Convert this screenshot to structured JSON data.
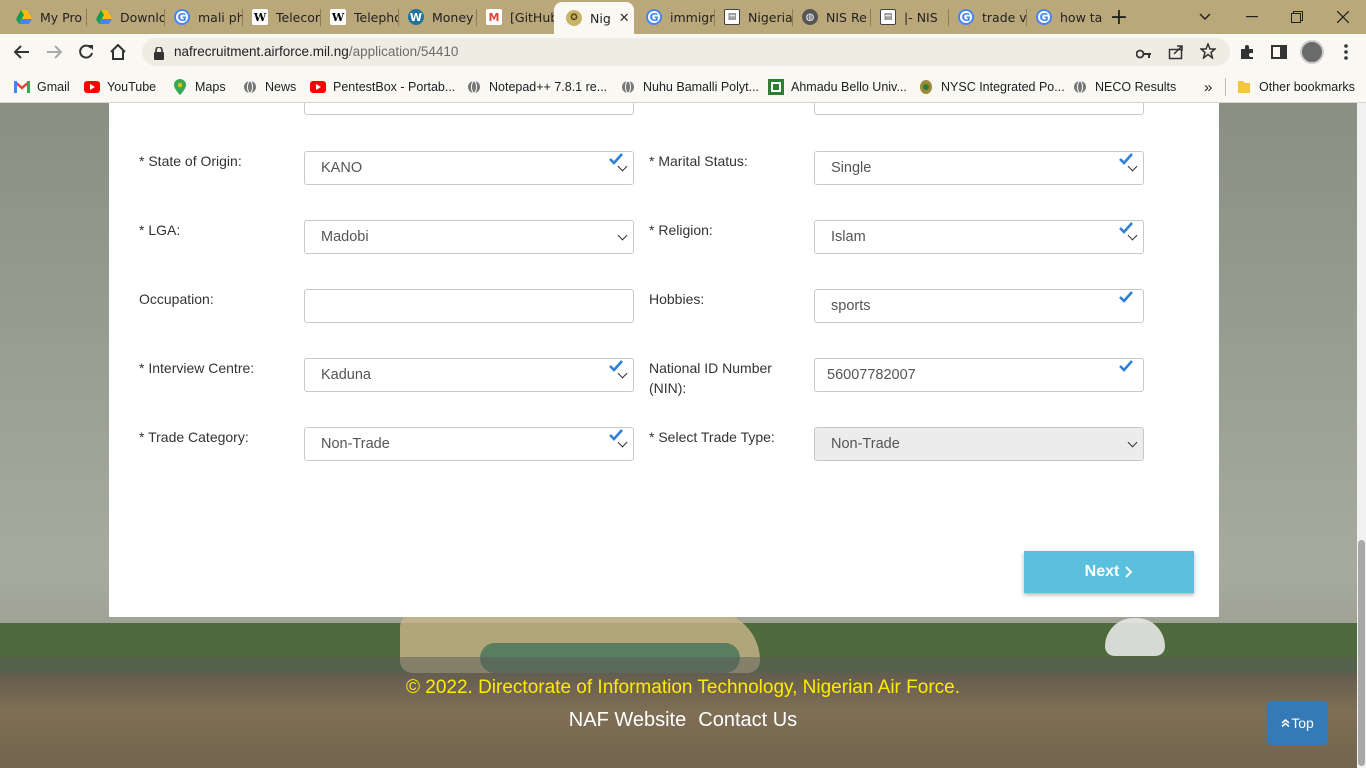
{
  "browser": {
    "tabs": [
      {
        "label": "My Pro",
        "icon": "google-drive-icon",
        "color": "#1a73e8"
      },
      {
        "label": "Downlo",
        "icon": "google-drive-icon",
        "color": "#1a73e8"
      },
      {
        "label": "mali ph",
        "icon": "google-icon",
        "color": "#4285f4"
      },
      {
        "label": "Telecor",
        "icon": "wikipedia-icon",
        "color": "#000000"
      },
      {
        "label": "Telepho",
        "icon": "wikipedia-icon",
        "color": "#000000"
      },
      {
        "label": "Money",
        "icon": "wordpress-icon",
        "color": "#21759b"
      },
      {
        "label": "[GitHub",
        "icon": "gmail-icon",
        "color": "#ea4335"
      },
      {
        "label": "Nig",
        "icon": "naf-crest-icon",
        "color": "#8a7a3a"
      },
      {
        "label": "immigr",
        "icon": "google-icon",
        "color": "#4285f4"
      },
      {
        "label": "Nigeria",
        "icon": "document-icon",
        "color": "#555555"
      },
      {
        "label": "NIS Re",
        "icon": "globe-icon",
        "color": "#555555"
      },
      {
        "label": "|- NIS",
        "icon": "document-icon",
        "color": "#555555"
      },
      {
        "label": "trade v",
        "icon": "google-icon",
        "color": "#4285f4"
      },
      {
        "label": "how ta",
        "icon": "google-icon",
        "color": "#4285f4"
      }
    ],
    "url_host": "nafrecruitment.airforce.mil.ng",
    "url_path": "/application/54410",
    "bookmarks": [
      {
        "label": "Gmail",
        "icon": "gmail-icon"
      },
      {
        "label": "YouTube",
        "icon": "youtube-icon"
      },
      {
        "label": "Maps",
        "icon": "maps-icon"
      },
      {
        "label": "News",
        "icon": "globe-icon"
      },
      {
        "label": "PentestBox - Portab...",
        "icon": "youtube-icon"
      },
      {
        "label": "Notepad++ 7.8.1 re...",
        "icon": "globe-icon"
      },
      {
        "label": "Nuhu Bamalli Polyt...",
        "icon": "globe-icon"
      },
      {
        "label": "Ahmadu Bello Univ...",
        "icon": "abu-crest-icon"
      },
      {
        "label": "NYSC Integrated Po...",
        "icon": "nysc-icon"
      },
      {
        "label": "NECO Results",
        "icon": "globe-icon"
      }
    ],
    "other_bookmarks": "Other bookmarks",
    "more": "»"
  },
  "form": {
    "state_label": "* State of Origin:",
    "state_value": "KANO",
    "marital_label": "* Marital Status:",
    "marital_value": "Single",
    "lga_label": "* LGA:",
    "lga_value": "Madobi",
    "religion_label": "* Religion:",
    "religion_value": "Islam",
    "occupation_label": "Occupation:",
    "occupation_value": "",
    "hobbies_label": "Hobbies:",
    "hobbies_value": "sports",
    "centre_label": "* Interview Centre:",
    "centre_value": "Kaduna",
    "nin_label_1": "National ID Number",
    "nin_label_2": "(NIN):",
    "nin_value": "56007782007",
    "trade_cat_label": "* Trade Category:",
    "trade_cat_value": "Non-Trade",
    "trade_type_label": "* Select Trade Type:",
    "trade_type_value": "Non-Trade",
    "next_label": "Next"
  },
  "footer": {
    "copyright": "© 2022. Directorate of Information Technology, Nigerian Air Force.",
    "naf_website": "NAF Website",
    "contact_us": "Contact Us",
    "top_label": "Top"
  },
  "colors": {
    "accent": "#5bc0de",
    "check": "#2e7fd9",
    "footer_text": "#ffeb00",
    "top_button": "#337ab7"
  }
}
